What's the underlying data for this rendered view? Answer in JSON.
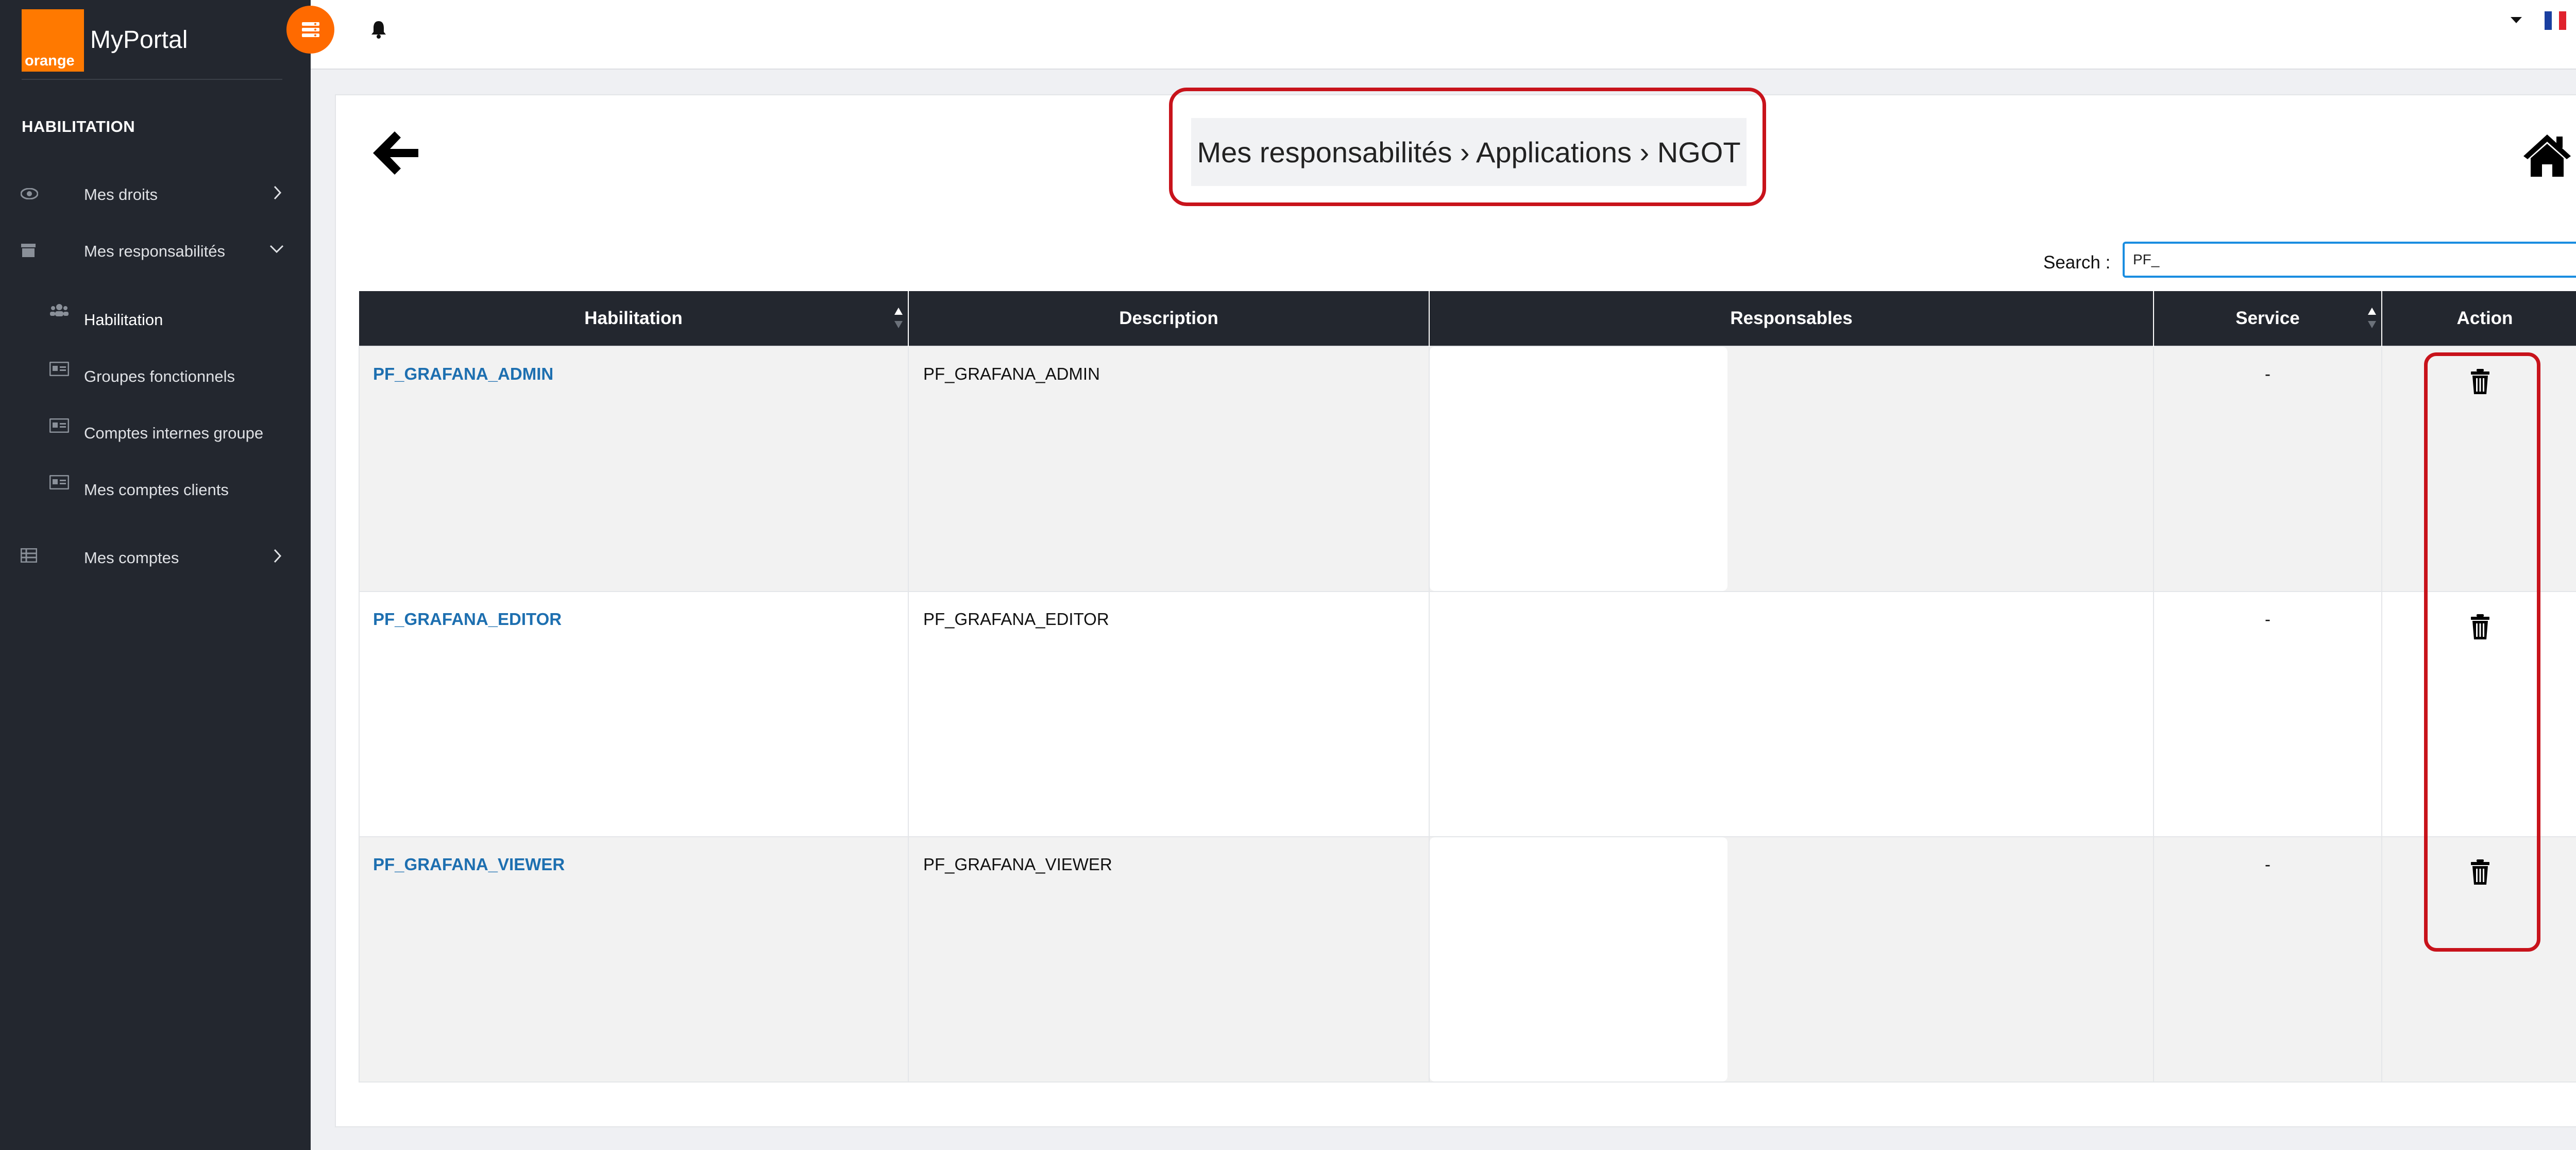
{
  "sidebar": {
    "logo_text": "orange",
    "brand": "MyPortal",
    "section_title": "HABILITATION",
    "items": [
      {
        "label": "Mes droits"
      },
      {
        "label": "Mes responsabilités"
      },
      {
        "label": "Habilitation"
      },
      {
        "label": "Groupes fonctionnels"
      },
      {
        "label": "Comptes internes groupe"
      },
      {
        "label": "Mes comptes clients"
      },
      {
        "label": "Mes comptes"
      }
    ]
  },
  "header": {
    "breadcrumb": "Mes responsabilités › Applications › NGOT"
  },
  "search": {
    "label": "Search :",
    "value": "PF_"
  },
  "table": {
    "columns": [
      "Habilitation",
      "Description",
      "Responsables",
      "Service",
      "Action"
    ],
    "rows": [
      {
        "habilitation": "PF_GRAFANA_ADMIN",
        "description": "PF_GRAFANA_ADMIN",
        "service": "-"
      },
      {
        "habilitation": "PF_GRAFANA_EDITOR",
        "description": "PF_GRAFANA_EDITOR",
        "service": "-"
      },
      {
        "habilitation": "PF_GRAFANA_VIEWER",
        "description": "PF_GRAFANA_VIEWER",
        "service": "-"
      }
    ]
  },
  "colors": {
    "sidebar_bg": "#23272f",
    "brand_orange": "#ff7900",
    "link_blue": "#1d6fb0",
    "highlight_red": "#c8131b",
    "focus_blue": "#1a8de0"
  }
}
